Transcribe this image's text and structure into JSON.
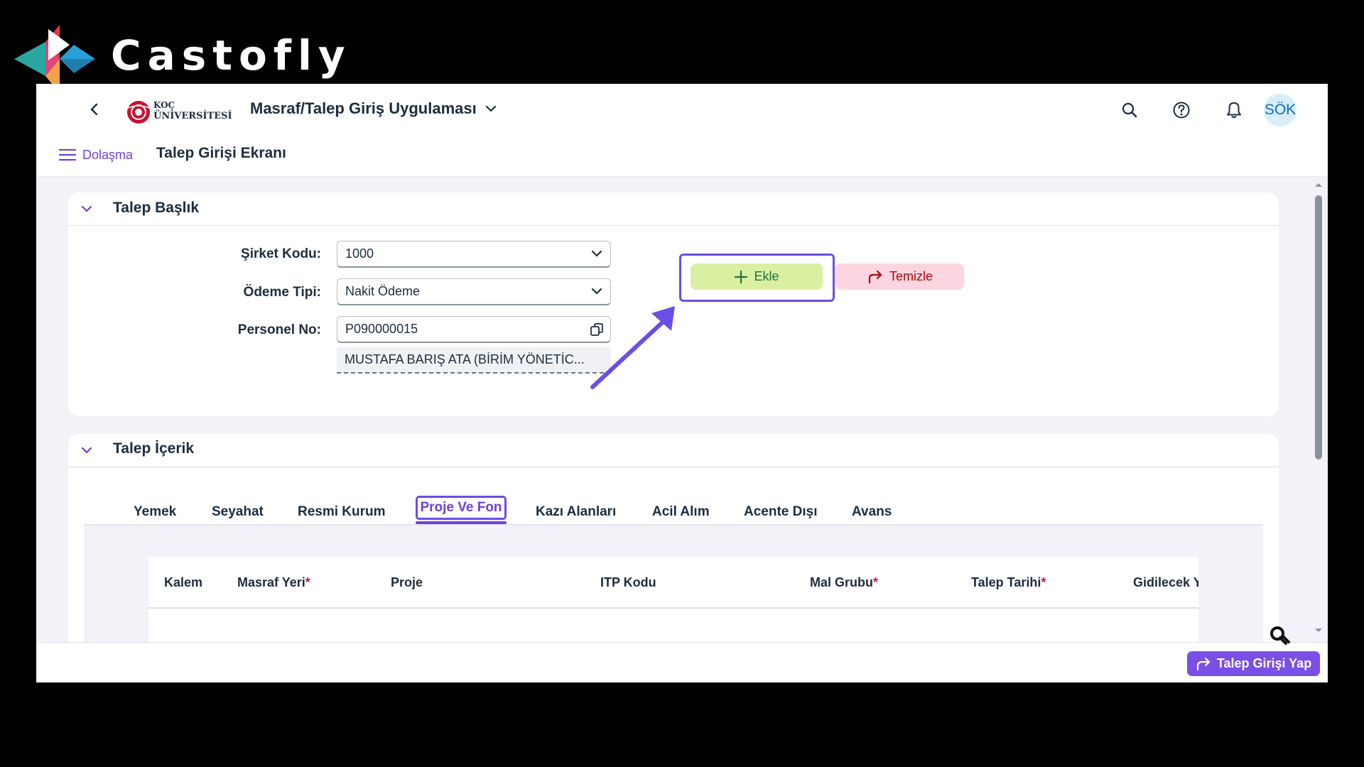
{
  "brand": {
    "name": "Castofly"
  },
  "shellbar": {
    "logo_line1": "KOÇ",
    "logo_line2": "ÜNİVERSİTESİ",
    "app_title": "Masraf/Talep Giriş Uygulaması",
    "avatar_initials": "SÖK"
  },
  "subheader": {
    "nav_label": "Dolaşma",
    "page_title": "Talep Girişi Ekranı"
  },
  "header_section": {
    "title": "Talep Başlık",
    "fields": {
      "sirket_label": "Şirket Kodu:",
      "sirket_value": "1000",
      "odeme_label": "Ödeme Tipi:",
      "odeme_value": "Nakit Ödeme",
      "personel_label": "Personel No:",
      "personel_value": "P090000015",
      "personel_name": "MUSTAFA BARIŞ  ATA (BİRİM YÖNETİC..."
    },
    "buttons": {
      "add": "Ekle",
      "clear": "Temizle"
    }
  },
  "content_section": {
    "title": "Talep İçerik",
    "tabs": [
      "Yemek",
      "Seyahat",
      "Resmi Kurum",
      "Proje Ve Fon",
      "Kazı Alanları",
      "Acil Alım",
      "Acente Dışı",
      "Avans"
    ],
    "active_tab": "Proje Ve Fon",
    "table_headers": [
      "Kalem",
      "Masraf Yeri",
      "Proje",
      "ITP Kodu",
      "Mal Grubu",
      "Talep Tarihi",
      "Gidilecek Y"
    ],
    "required_mark": "*"
  },
  "footer": {
    "submit_label": "Talep Girişi Yap"
  },
  "colors": {
    "accent": "#6c4de6",
    "add_button_bg": "#d9f0a3",
    "clear_button_bg": "#fcd5e1",
    "clear_text": "#aa0808",
    "required": "#c0185b",
    "nav_purple": "#7240d6"
  },
  "icons": [
    "back-chevron-icon",
    "search-icon",
    "help-icon",
    "bell-icon",
    "menu-icon",
    "collapse-chevron-icon",
    "dropdown-chevron-icon",
    "value-help-icon",
    "plus-icon",
    "redo-arrow-icon",
    "share-arrow-icon"
  ]
}
